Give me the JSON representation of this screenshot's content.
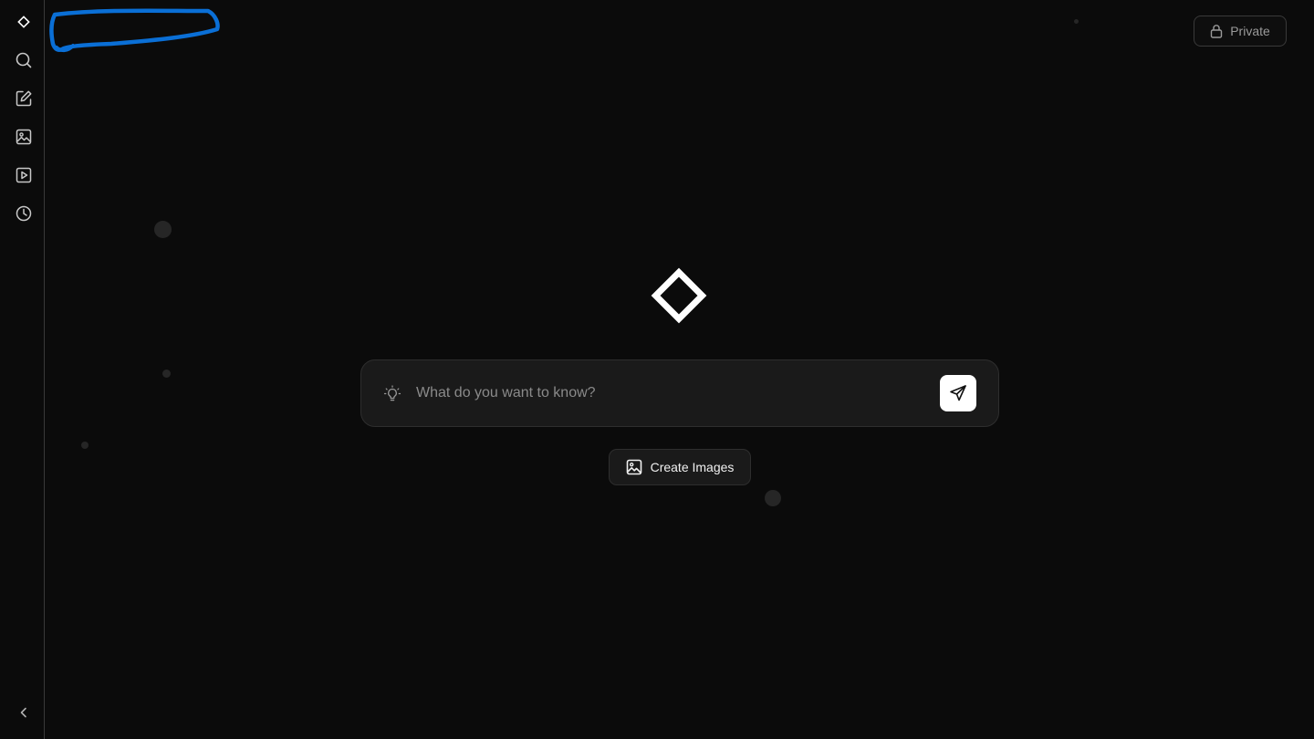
{
  "header": {
    "private_label": "Private"
  },
  "sidebar": {
    "items": [
      {
        "icon": "logo-diamond-icon"
      },
      {
        "icon": "search-icon"
      },
      {
        "icon": "new-chat-icon"
      },
      {
        "icon": "image-icon"
      },
      {
        "icon": "video-icon"
      },
      {
        "icon": "history-icon"
      }
    ],
    "collapse_icon": "chevron-left-icon"
  },
  "search": {
    "placeholder": "What do you want to know?",
    "value": ""
  },
  "actions": {
    "create_images_label": "Create Images"
  },
  "colors": {
    "background": "#0b0b0b",
    "surface": "#1a1a1a",
    "annotation": "#0a6fd6",
    "send_button": "#ffffff"
  }
}
